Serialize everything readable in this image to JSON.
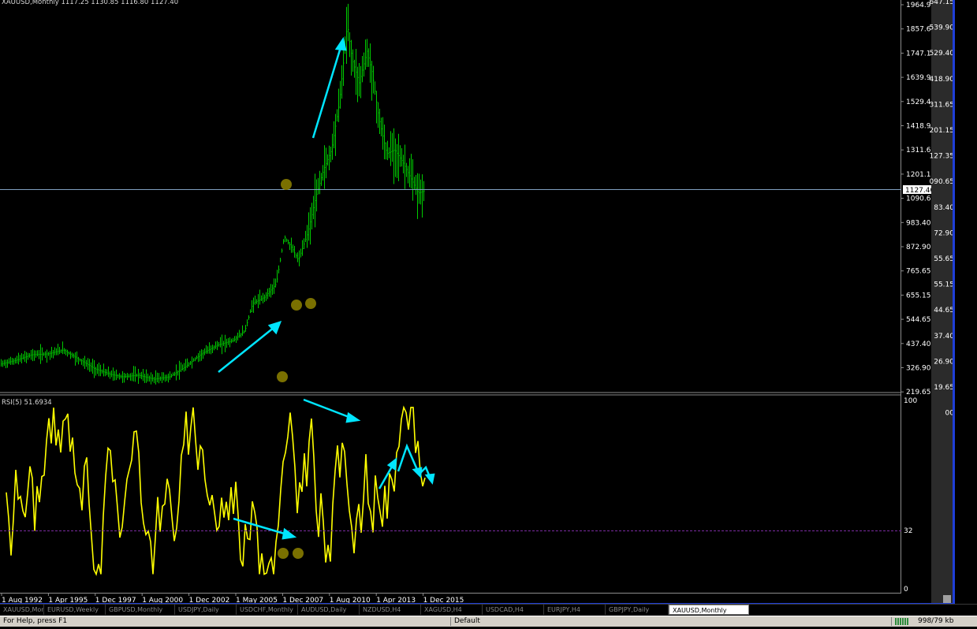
{
  "chart": {
    "title": "XAUUSD,Monthly  1117.25 1130.85 1116.80 1127.40",
    "price_labels": [
      "1964.90",
      "1857.65",
      "1747.15",
      "1639.90",
      "1529.40",
      "1418.90",
      "1311.65",
      "1201.15",
      "1090.65",
      "983.40",
      "872.90",
      "765.65",
      "655.15",
      "544.65",
      "437.40",
      "326.90",
      "219.65"
    ],
    "current_price": "1127.40",
    "time_labels": [
      "1 Aug 1992",
      "1 Apr 1995",
      "1 Dec 1997",
      "1 Aug 2000",
      "1 Dec 2002",
      "1 May 2005",
      "1 Dec 2007",
      "1 Aug 2010",
      "1 Apr 2013",
      "1 Dec 2015"
    ],
    "right_panel_labels": [
      "647.15",
      "539.90",
      "529.40",
      "418.90",
      "311.65",
      "201.15",
      "127.35",
      "090.65",
      "83.40",
      "72.90",
      "55.65",
      "55.15",
      "44.65",
      "37.40",
      "26.90",
      "19.65",
      "00"
    ],
    "colors": {
      "price": "#00cc00",
      "rsi": "#ffff00",
      "arrows": "#00e5ff",
      "dots": "#7a7000",
      "hline": "#7f9fbf",
      "level": "#7a2ca0"
    }
  },
  "rsi": {
    "title": "RSI(5) 51.6934",
    "levels": [
      "100",
      "32",
      "0"
    ]
  },
  "tabs": [
    "XAUUSD,Monthly",
    "EURUSD,Weekly",
    "GBPUSD,Monthly",
    "USDJPY,Daily",
    "USDCHF,Monthly",
    "AUDUSD,Daily",
    "NZDUSD,H4",
    "XAGUSD,H4",
    "USDCAD,H4",
    "EURJPY,H4",
    "GBPJPY,Daily",
    "XAUUSD,Monthly"
  ],
  "status": {
    "help": "For Help, press F1",
    "profile": "Default",
    "traffic": "998/79 kb"
  }
}
